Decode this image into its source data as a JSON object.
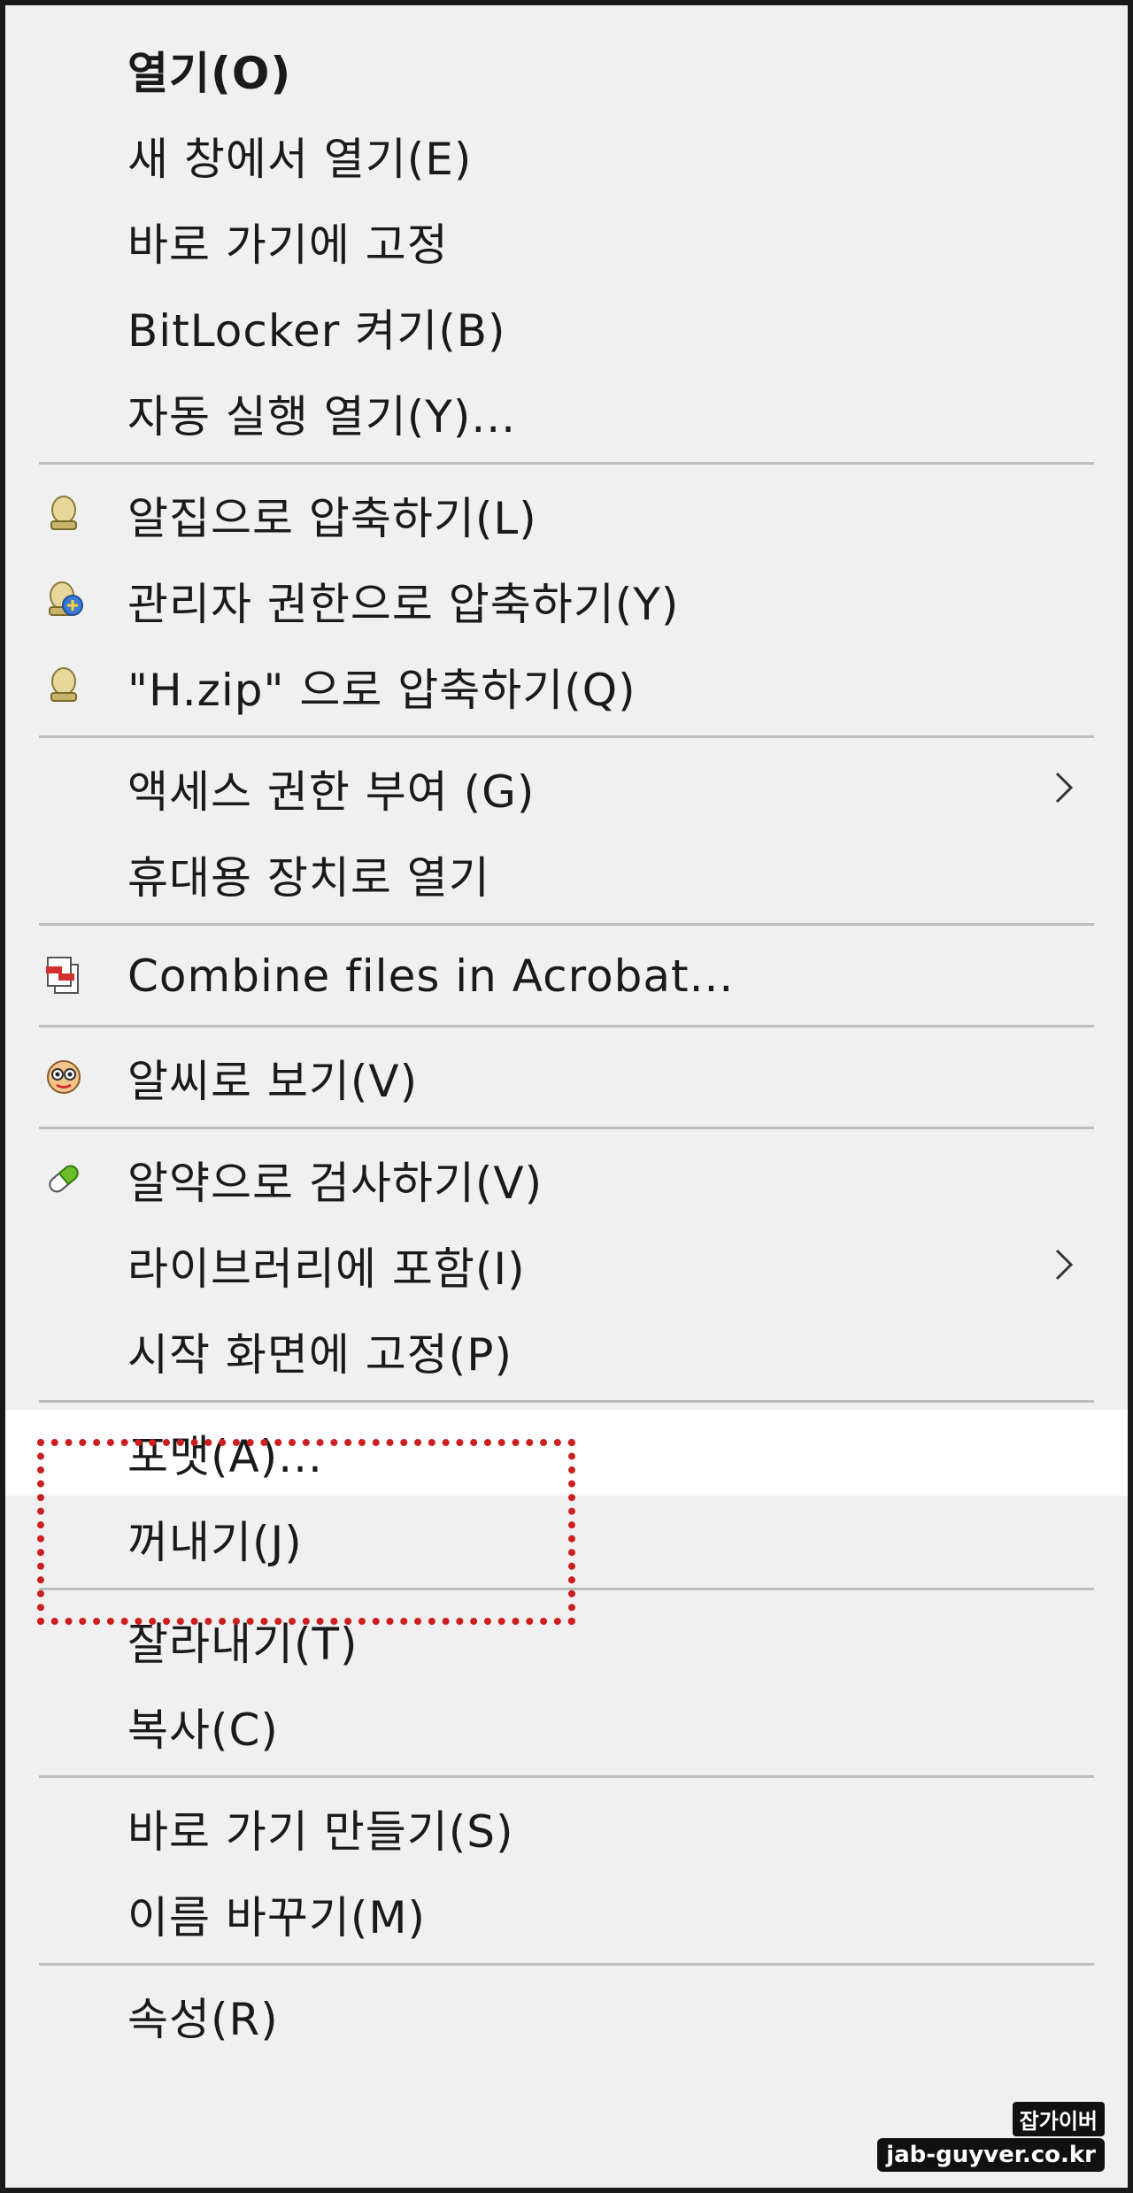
{
  "menu": {
    "items": [
      {
        "label": "열기(O)"
      },
      {
        "label": "새 창에서 열기(E)"
      },
      {
        "label": "바로 가기에 고정"
      },
      {
        "label": "BitLocker 켜기(B)"
      },
      {
        "label": "자동 실행 열기(Y)..."
      },
      {
        "label": "알집으로 압축하기(L)",
        "icon": "alzip-icon"
      },
      {
        "label": "관리자 권한으로 압축하기(Y)",
        "icon": "alzip-admin-icon"
      },
      {
        "label": "\"H.zip\" 으로 압축하기(Q)",
        "icon": "alzip-icon"
      },
      {
        "label": "액세스 권한 부여 (G)",
        "submenu": true
      },
      {
        "label": "휴대용 장치로 열기"
      },
      {
        "label": "Combine files in Acrobat...",
        "icon": "acrobat-combine-icon"
      },
      {
        "label": "알씨로 보기(V)",
        "icon": "alsee-icon"
      },
      {
        "label": "알약으로 검사하기(V)",
        "icon": "alyac-pill-icon"
      },
      {
        "label": "라이브러리에 포함(I)",
        "submenu": true
      },
      {
        "label": "시작 화면에 고정(P)"
      },
      {
        "label": "포맷(A)...",
        "highlighted": true
      },
      {
        "label": "꺼내기(J)"
      },
      {
        "label": "잘라내기(T)"
      },
      {
        "label": "복사(C)"
      },
      {
        "label": "바로 가기 만들기(S)"
      },
      {
        "label": "이름 바꾸기(M)"
      },
      {
        "label": "속성(R)"
      }
    ]
  },
  "annotation": {
    "color": "#cc1f1f"
  },
  "watermark": {
    "line1": "잡가이버",
    "line2": "jab-guyver.co.kr"
  }
}
